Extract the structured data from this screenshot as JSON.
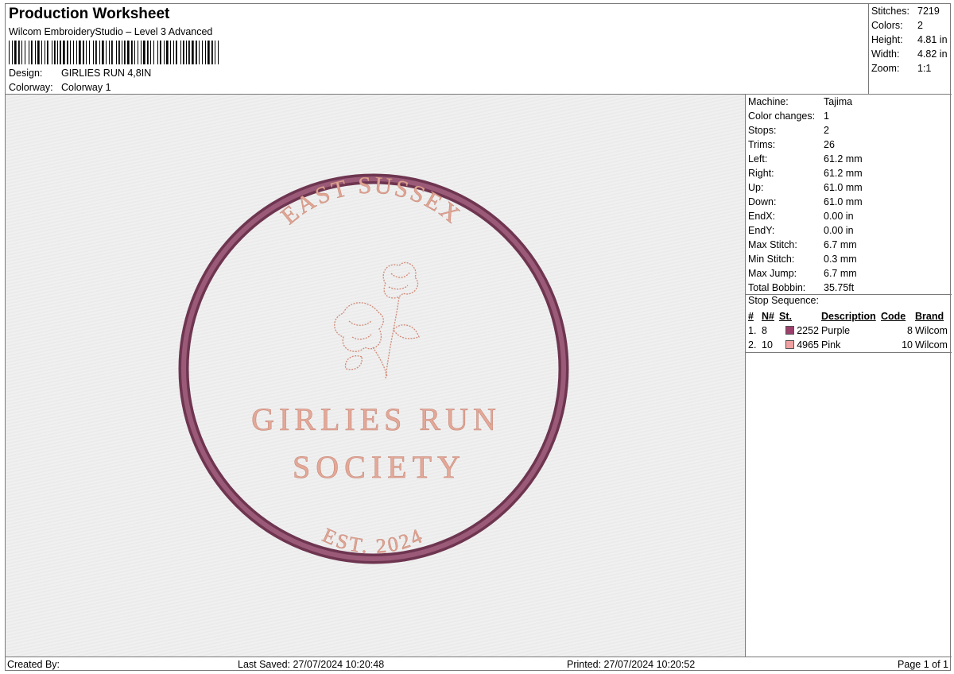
{
  "header": {
    "title": "Production Worksheet",
    "subtitle": "Wilcom EmbroideryStudio – Level 3 Advanced",
    "design_label": "Design:",
    "design_value": "GIRLIES RUN 4,8IN",
    "colorway_label": "Colorway:",
    "colorway_value": "Colorway 1"
  },
  "stats": [
    {
      "label": "Stitches:",
      "value": "7219"
    },
    {
      "label": "Colors:",
      "value": "2"
    },
    {
      "label": "Height:",
      "value": "4.81 in"
    },
    {
      "label": "Width:",
      "value": "4.82 in"
    },
    {
      "label": "Zoom:",
      "value": "1:1"
    }
  ],
  "design": {
    "top_text": "EAST SUSSEX",
    "main_line1": "GIRLIES RUN",
    "main_line2": "SOCIETY",
    "bottom_text": "EST. 2024",
    "ring_color": "#8a4a68",
    "text_color": "#e0a594"
  },
  "machine": [
    {
      "label": "Machine:",
      "value": "Tajima"
    },
    {
      "label": "Color changes:",
      "value": "1"
    },
    {
      "label": "Stops:",
      "value": "2"
    },
    {
      "label": "Trims:",
      "value": "26"
    },
    {
      "label": "Left:",
      "value": "61.2 mm"
    },
    {
      "label": "Right:",
      "value": "61.2 mm"
    },
    {
      "label": "Up:",
      "value": "61.0 mm"
    },
    {
      "label": "Down:",
      "value": "61.0 mm"
    },
    {
      "label": "EndX:",
      "value": "0.00 in"
    },
    {
      "label": "EndY:",
      "value": "0.00 in"
    },
    {
      "label": "Max Stitch:",
      "value": "6.7 mm"
    },
    {
      "label": "Min Stitch:",
      "value": "0.3 mm"
    },
    {
      "label": "Max Jump:",
      "value": "6.7 mm"
    },
    {
      "label": "Total Bobbin:",
      "value": "35.75ft"
    }
  ],
  "stop_sequence": {
    "title": "Stop Sequence:",
    "headers": [
      "#",
      "N#",
      "St.",
      "Description",
      "Code",
      "Brand"
    ],
    "rows": [
      {
        "num": "1.",
        "n": "8",
        "color": "#9b3f6b",
        "st": "2252",
        "desc": "Purple",
        "code": "8",
        "brand": "Wilcom"
      },
      {
        "num": "2.",
        "n": "10",
        "color": "#f0a0a0",
        "st": "4965",
        "desc": "Pink",
        "code": "10",
        "brand": "Wilcom"
      }
    ]
  },
  "footer": {
    "created_by": "Created By:",
    "last_saved": "Last Saved: 27/07/2024 10:20:48",
    "printed": "Printed: 27/07/2024 10:20:52",
    "page": "Page 1 of 1"
  }
}
